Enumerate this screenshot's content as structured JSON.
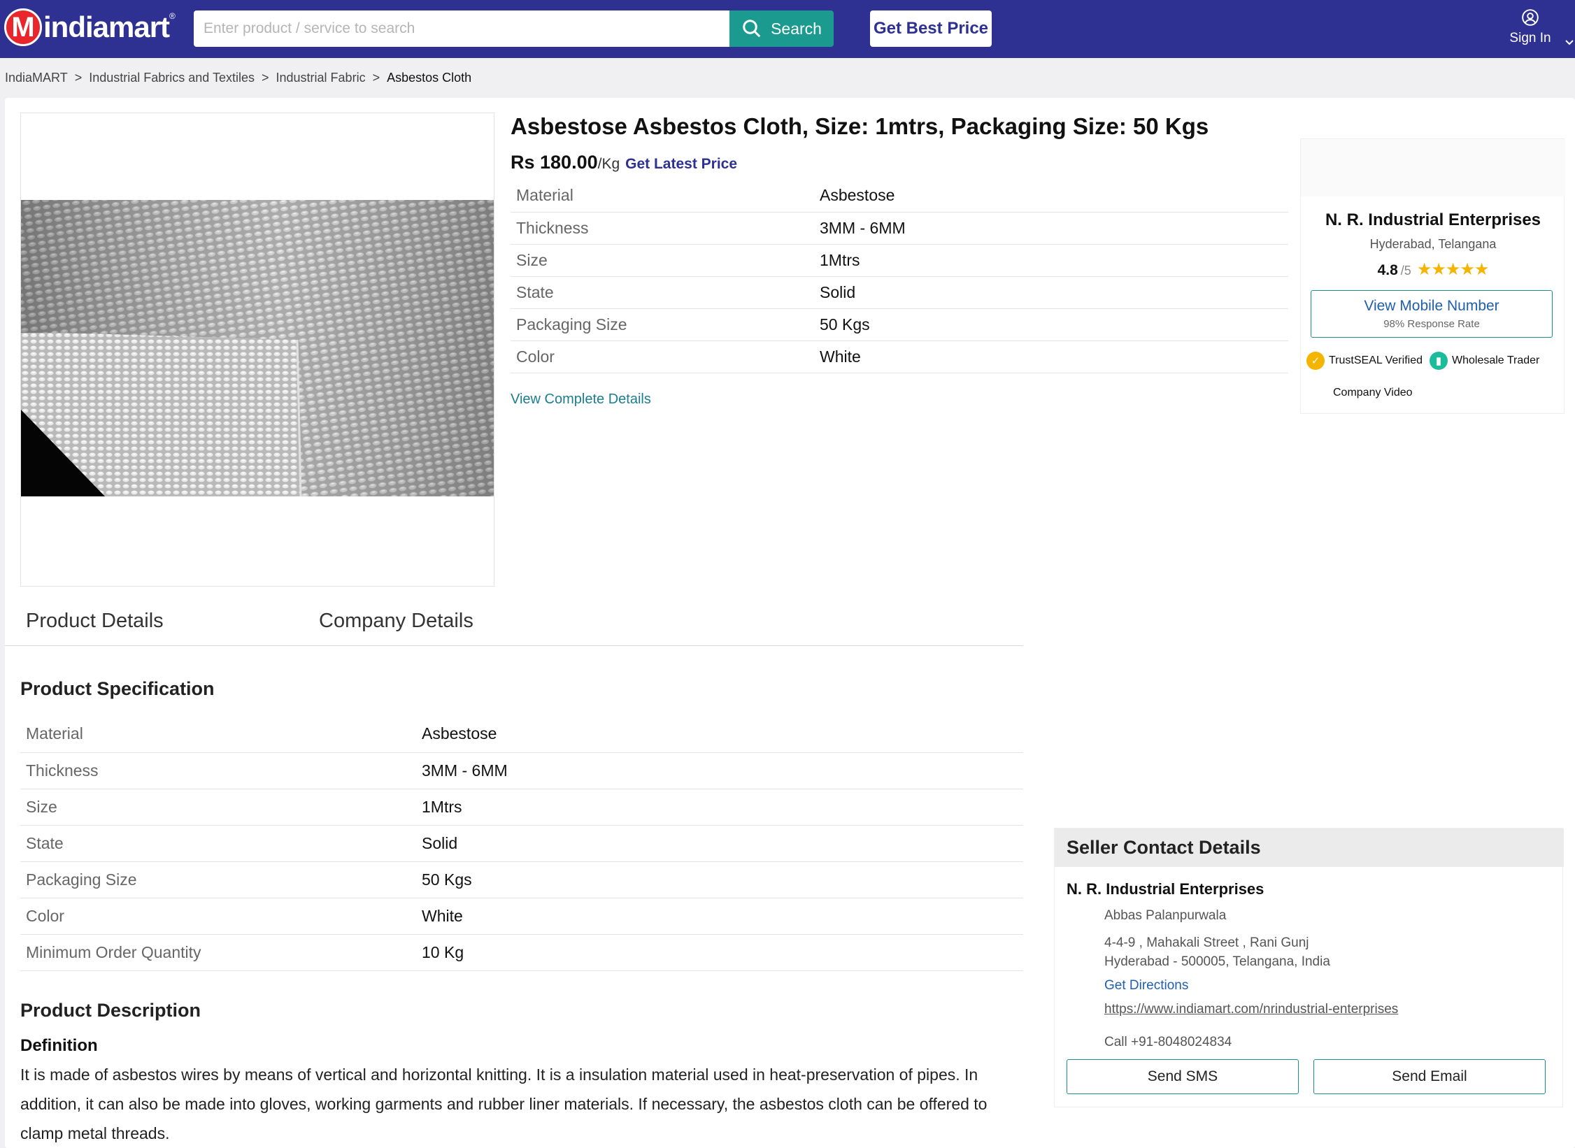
{
  "header": {
    "logo_letter": "M",
    "logo_text": "indiamart",
    "search_placeholder": "Enter product / service to search",
    "search_label": "Search",
    "best_price_label": "Get Best Price",
    "signin_label": "Sign In",
    "bg_color": "#2e3192",
    "accent_color": "#1b9b8f"
  },
  "breadcrumb": {
    "items": [
      "IndiaMART",
      "Industrial Fabrics and Textiles",
      "Industrial Fabric",
      "Asbestos Cloth"
    ],
    "separator": ">"
  },
  "product": {
    "title": "Asbestose Asbestos Cloth, Size: 1mtrs, Packaging Size: 50 Kgs",
    "price": "Rs 180.00",
    "unit": "/Kg",
    "latest_price_label": "Get Latest Price",
    "specs": [
      {
        "key": "Material",
        "value": "Asbestose"
      },
      {
        "key": "Thickness",
        "value": "3MM - 6MM"
      },
      {
        "key": "Size",
        "value": "1Mtrs"
      },
      {
        "key": "State",
        "value": "Solid"
      },
      {
        "key": "Packaging Size",
        "value": "50 Kgs"
      },
      {
        "key": "Color",
        "value": "White"
      }
    ],
    "view_complete_label": "View Complete Details"
  },
  "seller_card": {
    "name": "N. R. Industrial Enterprises",
    "location": "Hyderabad, Telangana",
    "rating": "4.8",
    "rating_max": "/5",
    "stars": "★★★★★",
    "view_mobile_label": "View Mobile Number",
    "response_rate": "98% Response Rate",
    "badge_trustseal": "TrustSEAL Verified",
    "badge_trader": "Wholesale Trader",
    "company_video": "Company Video",
    "star_color": "#f4b400"
  },
  "tabs": [
    "Product Details",
    "Company Details"
  ],
  "specification": {
    "heading": "Product Specification",
    "rows": [
      {
        "key": "Material",
        "value": "Asbestose"
      },
      {
        "key": "Thickness",
        "value": "3MM - 6MM"
      },
      {
        "key": "Size",
        "value": "1Mtrs"
      },
      {
        "key": "State",
        "value": "Solid"
      },
      {
        "key": "Packaging Size",
        "value": "50 Kgs"
      },
      {
        "key": "Color",
        "value": "White"
      },
      {
        "key": "Minimum Order Quantity",
        "value": "10 Kg"
      }
    ]
  },
  "description": {
    "heading": "Product Description",
    "subheading": "Definition",
    "text": "It is made of asbestos wires by means of vertical and horizontal knitting. It is a insulation material used in heat-preservation of pipes. In addition, it can also be made into gloves, working garments and rubber liner materials. If necessary, the asbestos cloth can be offered to clamp metal threads."
  },
  "contact": {
    "heading": "Seller Contact Details",
    "company": "N. R. Industrial Enterprises",
    "person": "Abbas Palanpurwala",
    "address_line1": "4-4-9 , Mahakali Street , Rani Gunj",
    "address_line2": "Hyderabad - 500005, Telangana, India",
    "directions_label": "Get Directions",
    "url": "https://www.indiamart.com/nrindustrial-enterprises",
    "call": "Call +91-8048024834",
    "sms_label": "Send SMS",
    "email_label": "Send Email"
  }
}
